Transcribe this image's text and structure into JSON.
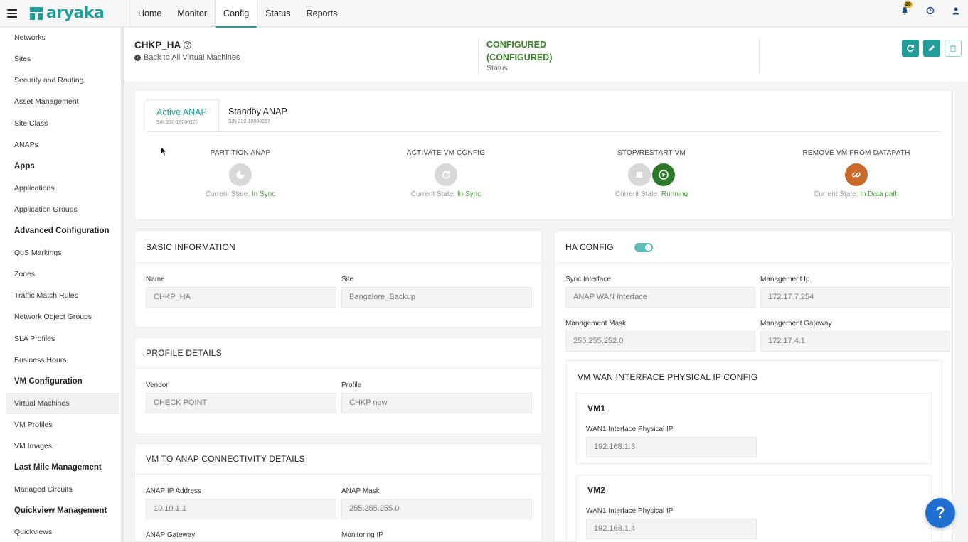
{
  "brand": {
    "name": "aryaka",
    "color": "#1e9f9a"
  },
  "nav": {
    "tabs": [
      {
        "label": "Home"
      },
      {
        "label": "Monitor"
      },
      {
        "label": "Config"
      },
      {
        "label": "Status"
      },
      {
        "label": "Reports"
      }
    ],
    "active_tab": "Config",
    "notification_count": "20"
  },
  "sidebar": {
    "items": [
      {
        "label": "Networks",
        "type": "item"
      },
      {
        "label": "Sites",
        "type": "item"
      },
      {
        "label": "Security and Routing",
        "type": "item"
      },
      {
        "label": "Asset Management",
        "type": "item"
      },
      {
        "label": "Site Class",
        "type": "item"
      },
      {
        "label": "ANAPs",
        "type": "item"
      },
      {
        "label": "Apps",
        "type": "header"
      },
      {
        "label": "Applications",
        "type": "item"
      },
      {
        "label": "Application Groups",
        "type": "item"
      },
      {
        "label": "Advanced Configuration",
        "type": "header"
      },
      {
        "label": "QoS Markings",
        "type": "item"
      },
      {
        "label": "Zones",
        "type": "item"
      },
      {
        "label": "Traffic Match Rules",
        "type": "item"
      },
      {
        "label": "Network Object Groups",
        "type": "item"
      },
      {
        "label": "SLA Profiles",
        "type": "item"
      },
      {
        "label": "Business Hours",
        "type": "item"
      },
      {
        "label": "VM Configuration",
        "type": "header"
      },
      {
        "label": "Virtual Machines",
        "type": "item"
      },
      {
        "label": "VM Profiles",
        "type": "item"
      },
      {
        "label": "VM Images",
        "type": "item"
      },
      {
        "label": "Last Mile Management",
        "type": "header"
      },
      {
        "label": "Managed Circuits",
        "type": "item"
      },
      {
        "label": "Quickview Management",
        "type": "header"
      },
      {
        "label": "Quickviews",
        "type": "item"
      }
    ],
    "selected": "Virtual Machines"
  },
  "page": {
    "title": "CHKP_HA",
    "back_link": "Back to All Virtual Machines",
    "status_value_line1": "CONFIGURED",
    "status_value_line2": "(CONFIGURED)",
    "status_label": "Status",
    "status_color": "#3a7d28"
  },
  "anap_tabs": [
    {
      "name": "Active ANAP",
      "sn": "S/N 230-10000170"
    },
    {
      "name": "Standby ANAP",
      "sn": "S/N 230-10000287"
    }
  ],
  "anap_actions": [
    {
      "title": "PARTITION ANAP",
      "state_prefix": "Current State:",
      "state": "In Sync"
    },
    {
      "title": "ACTIVATE VM CONFIG",
      "state_prefix": "Current State:",
      "state": "In Sync"
    },
    {
      "title": "STOP/RESTART VM",
      "state_prefix": "Current State:",
      "state": "Running"
    },
    {
      "title": "REMOVE VM FROM DATAPATH",
      "state_prefix": "Current State:",
      "state": "In Data path"
    }
  ],
  "basic_info": {
    "heading": "BASIC INFORMATION",
    "name_label": "Name",
    "name_value": "CHKP_HA",
    "site_label": "Site",
    "site_value": "Bangalore_Backup"
  },
  "profile_details": {
    "heading": "PROFILE DETAILS",
    "vendor_label": "Vendor",
    "vendor_value": "CHECK POINT",
    "profile_label": "Profile",
    "profile_value": "CHKP new"
  },
  "connectivity": {
    "heading": "VM TO ANAP CONNECTIVITY DETAILS",
    "ip_label": "ANAP IP Address",
    "ip_value": "10.10.1.1",
    "mask_label": "ANAP Mask",
    "mask_value": "255.255.255.0",
    "gateway_label": "ANAP Gateway",
    "monitoring_label": "Monitoring IP"
  },
  "ha_config": {
    "heading": "HA CONFIG",
    "enabled": true,
    "sync_label": "Sync Interface",
    "sync_value": "ANAP WAN Interface",
    "mgmt_ip_label": "Management Ip",
    "mgmt_ip_value": "172.17.7.254",
    "mgmt_mask_label": "Management Mask",
    "mgmt_mask_value": "255.255.252.0",
    "mgmt_gw_label": "Management Gateway",
    "mgmt_gw_value": "172.17.4.1",
    "wan_heading": "VM WAN INTERFACE PHYSICAL IP CONFIG",
    "vms": [
      {
        "name": "VM1",
        "label": "WAN1 Interface Physical IP",
        "value": "192.168.1.3"
      },
      {
        "name": "VM2",
        "label": "WAN1 Interface Physical IP",
        "value": "192.168.1.4"
      }
    ]
  },
  "help_button": "?"
}
